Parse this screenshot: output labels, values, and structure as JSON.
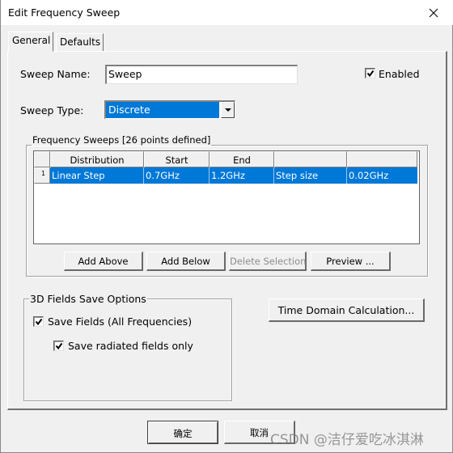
{
  "window": {
    "title": "Edit Frequency Sweep",
    "close_icon": "close-icon"
  },
  "tabs": [
    {
      "label": "General",
      "active": true
    },
    {
      "label": "Defaults",
      "active": false
    }
  ],
  "general": {
    "sweep_name_label": "Sweep Name:",
    "sweep_name_value": "Sweep",
    "enabled_label": "Enabled",
    "enabled_checked": true,
    "sweep_type_label": "Sweep Type:",
    "sweep_type_value": "Discrete",
    "frequency_sweeps": {
      "title": "Frequency Sweeps [26 points defined]",
      "columns": [
        "Distribution",
        "Start",
        "End",
        "",
        ""
      ],
      "rows": [
        {
          "index": "1",
          "cells": [
            "Linear Step",
            "0.7GHz",
            "1.2GHz",
            "Step size",
            "0.02GHz"
          ],
          "selected": true
        }
      ],
      "buttons": {
        "add_above": "Add Above",
        "add_below": "Add Below",
        "delete_selection": "Delete Selection",
        "preview": "Preview ..."
      }
    },
    "fields_save": {
      "title": "3D Fields Save Options",
      "save_fields_label": "Save Fields (All Frequencies)",
      "save_fields_checked": true,
      "save_radiated_label": "Save radiated fields only",
      "save_radiated_checked": true
    },
    "time_domain_button": "Time Domain Calculation..."
  },
  "footer": {
    "ok_label": "确定",
    "cancel_label": "取消"
  },
  "watermark": "CSDN @洁仔爱吃冰淇淋",
  "colors": {
    "selection": "#0078d7",
    "background": "#f0f0f0"
  }
}
